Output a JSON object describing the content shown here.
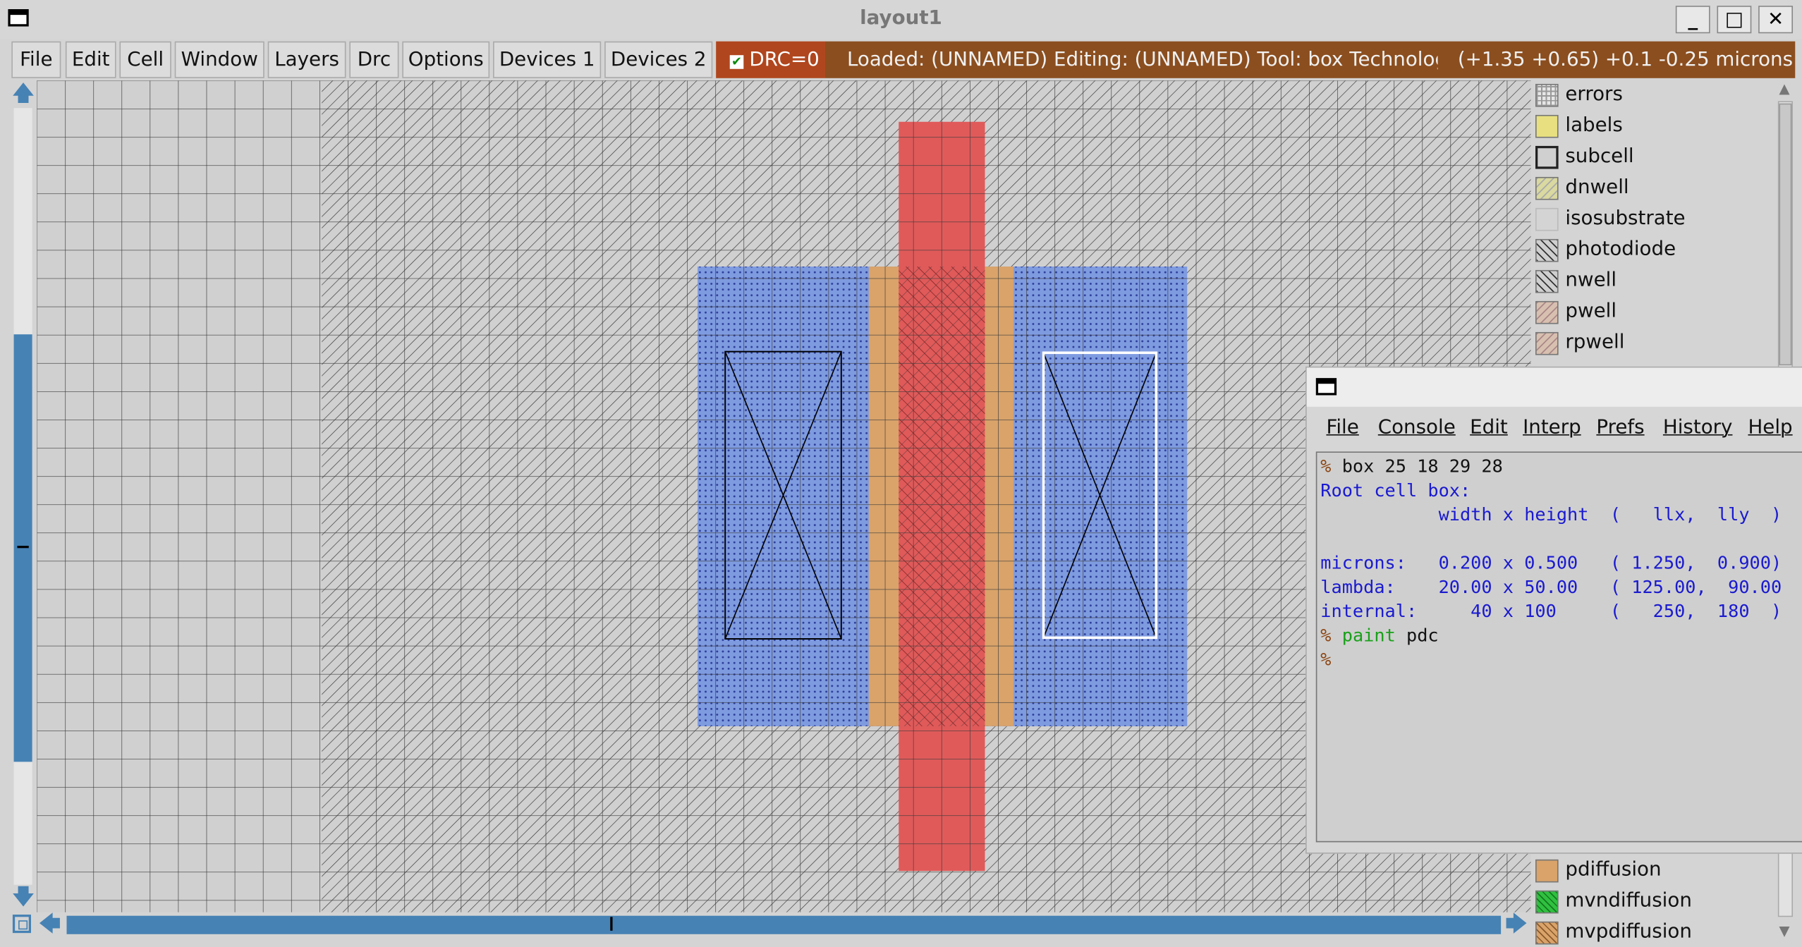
{
  "window": {
    "title": "layout1",
    "controls": [
      "_",
      "□",
      "✕"
    ]
  },
  "menubar": {
    "items": [
      "File",
      "Edit",
      "Cell",
      "Window",
      "Layers",
      "Drc",
      "Options",
      "Devices 1",
      "Devices 2"
    ],
    "drc_label": "DRC=0",
    "status_text": "Loaded: (UNNAMED) Editing: (UNNAMED) Tool: box  Technology",
    "coords_text": "(+1.35 +0.65) +0.1 -0.25 microns"
  },
  "colors": {
    "status_bg": "#8b4e1f",
    "drc_bg": "#b0461e",
    "scroll_accent": "#4682b4",
    "ndiffusion": "#7f9be0",
    "polysilicon": "#e05a5a",
    "pdiffusion": "#d9a36a"
  },
  "layers": {
    "top": [
      {
        "name": "errors",
        "icon": "errors-swatch-icon",
        "color": "#e6e6e6"
      },
      {
        "name": "labels",
        "icon": "labels-swatch-icon",
        "color": "#e8e080"
      },
      {
        "name": "subcell",
        "icon": "subcell-swatch-icon",
        "color": "#d0d0d0"
      },
      {
        "name": "dnwell",
        "icon": "dnwell-swatch-icon",
        "color": "#d9d9a0"
      },
      {
        "name": "isosubstrate",
        "icon": "isosubstrate-swatch-icon",
        "color": "#d4d4d4"
      },
      {
        "name": "photodiode",
        "icon": "photodiode-swatch-icon",
        "color": "#cfcfcf"
      },
      {
        "name": "nwell",
        "icon": "nwell-swatch-icon",
        "color": "#cfcfcf"
      },
      {
        "name": "pwell",
        "icon": "pwell-swatch-icon",
        "color": "#d8c0b0"
      },
      {
        "name": "rpwell",
        "icon": "rpwell-swatch-icon",
        "color": "#d8c0b0"
      }
    ],
    "bottom": [
      {
        "name": "pdiffusion",
        "icon": "pdiffusion-swatch-icon",
        "color": "#d9a36a"
      },
      {
        "name": "mvndiffusion",
        "icon": "mvndiffusion-swatch-icon",
        "color": "#30c040"
      },
      {
        "name": "mvpdiffusion",
        "icon": "mvpdiffusion-swatch-icon",
        "color": "#d9a36a"
      }
    ]
  },
  "console": {
    "menu": [
      "File",
      "Console",
      "Edit",
      "Interp",
      "Prefs",
      "History",
      "Help"
    ],
    "prompt": "%",
    "lines": {
      "l1_cmd": " box 25 18 29 28",
      "l2": "Root cell box:",
      "l3": "           width x height  (   llx,  lly  )",
      "l4": "",
      "l5": "microns:   0.200 x 0.500   ( 1.250,  0.900)",
      "l6": "lambda:    20.00 x 50.00   ( 125.00,  90.00",
      "l7": "internal:     40 x 100     (   250,  180  )",
      "l8_cmd": "paint",
      "l8_arg": " pdc"
    }
  }
}
